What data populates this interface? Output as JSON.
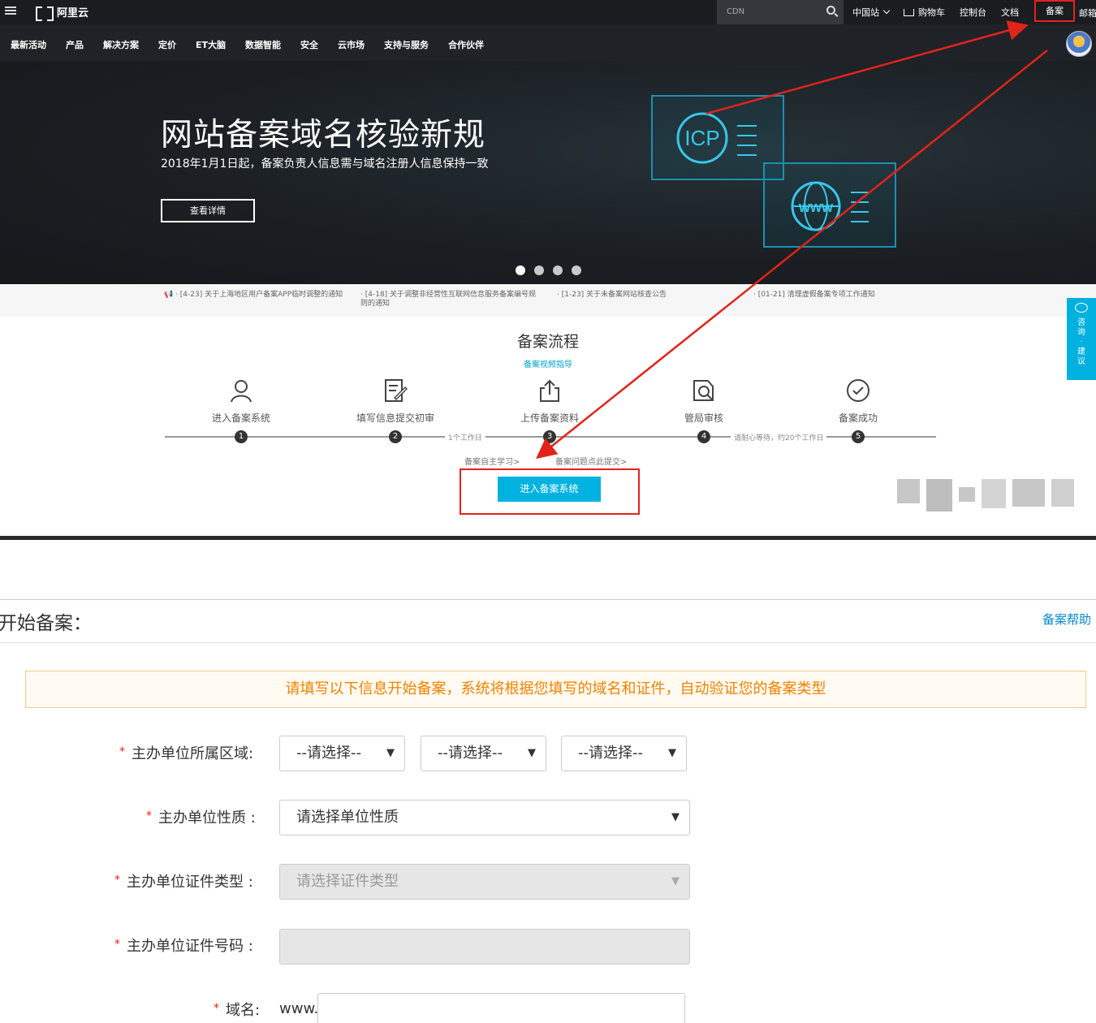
{
  "topbar": {
    "logo": "阿里云",
    "search_placeholder": "CDN",
    "links": [
      "中国站",
      "购物车",
      "控制台",
      "文档"
    ],
    "beian": "备案",
    "mail": "邮箱"
  },
  "nav": {
    "items": [
      "最新活动",
      "产品",
      "解决方案",
      "定价",
      "ET大脑",
      "数据智能",
      "安全",
      "云市场",
      "支持与服务",
      "合作伙伴"
    ]
  },
  "hero": {
    "title": "网站备案域名核验新规",
    "subtitle": "2018年1月1日起，备案负责人信息需与域名注册人信息保持一致",
    "button": "查看详情",
    "icp": "ICP",
    "www": "www"
  },
  "notices": [
    "[4-23] 关于上海地区用户备案APP临时调整的通知",
    "[4-18] 关于调整非经营性互联网信息服务备案编号规则的通知",
    "[1-23] 关于未备案网站核查公告",
    "[01-21] 清理虚假备案专项工作通知"
  ],
  "process": {
    "title": "备案流程",
    "video_link": "备案视频指导",
    "steps": [
      {
        "num": "1",
        "label": "进入备案系统"
      },
      {
        "num": "2",
        "label": "填写信息提交初审"
      },
      {
        "num": "3",
        "label": "上传备案资料"
      },
      {
        "num": "4",
        "label": "管局审核"
      },
      {
        "num": "5",
        "label": "备案成功"
      }
    ],
    "note_a": "1个工作日",
    "note_b": "请耐心等待，约20个工作日",
    "self_study": "备案自主学习>",
    "faq_link": "备案问题点此提交>",
    "enter_button": "进入备案系统"
  },
  "feedback": {
    "label_lines": [
      "咨",
      "询",
      "·",
      "建",
      "议"
    ]
  },
  "form": {
    "title": "开始备案：",
    "help": "备案帮助",
    "alert": "请填写以下信息开始备案，系统将根据您填写的域名和证件，自动验证您的备案类型",
    "region_label": "主办单位所属区域:",
    "region_placeholder": "--请选择--",
    "nature_label": "主办单位性质 :",
    "nature_placeholder": "请选择单位性质",
    "cert_type_label": "主办单位证件类型 :",
    "cert_type_placeholder": "请选择证件类型",
    "cert_no_label": "主办单位证件号码 :",
    "domain_label": "域名:",
    "www_prefix": "www."
  },
  "colors": {
    "highlight": "#e2231a",
    "accent": "#00b2e0",
    "alert_text": "#f08300"
  }
}
